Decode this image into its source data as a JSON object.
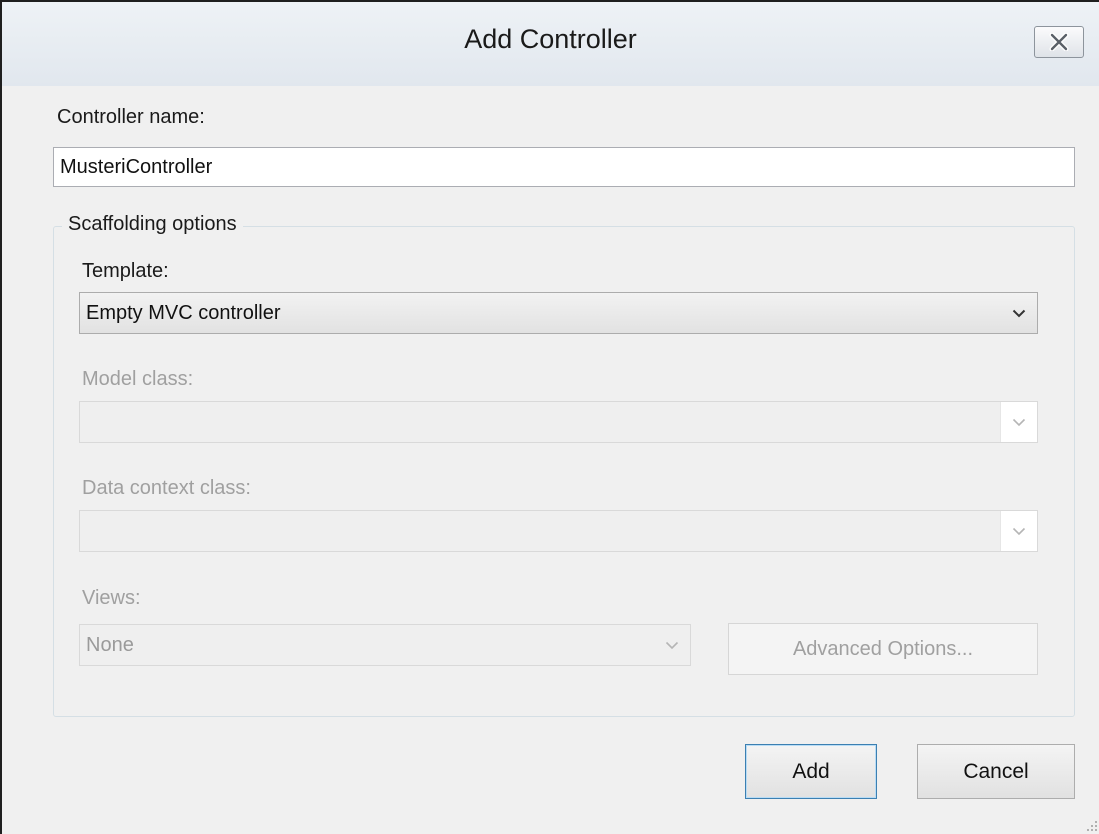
{
  "window": {
    "title": "Add Controller"
  },
  "controller_name": {
    "label": "Controller name:",
    "value": "MusteriController"
  },
  "scaffolding": {
    "group_label": "Scaffolding options",
    "template": {
      "label": "Template:",
      "selected": "Empty MVC controller"
    },
    "model_class": {
      "label": "Model class:",
      "selected": ""
    },
    "data_context_class": {
      "label": "Data context class:",
      "selected": ""
    },
    "views": {
      "label": "Views:",
      "selected": "None"
    },
    "advanced_options_label": "Advanced Options..."
  },
  "buttons": {
    "add_label": "Add",
    "cancel_label": "Cancel"
  },
  "icons": {
    "close": "close-icon",
    "dropdown": "chevron-down-icon",
    "resize": "resize-grip-icon"
  },
  "colors": {
    "default_button_border": "#3c7fb1",
    "disabled_text": "#a0a0a0"
  }
}
